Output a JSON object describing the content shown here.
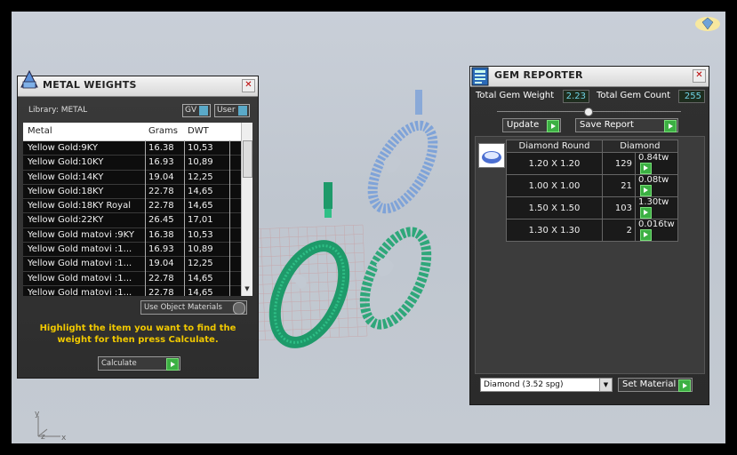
{
  "metal_weights": {
    "title": "METAL WEIGHTS",
    "close": "✕",
    "library": "Library: METAL",
    "toggle_gv": "GV",
    "toggle_user": "User",
    "columns": [
      "Metal",
      "Grams",
      "DWT"
    ],
    "rows": [
      {
        "metal": "Yellow Gold:9KY",
        "grams": "16.38",
        "dwt": "10,53"
      },
      {
        "metal": "Yellow Gold:10KY",
        "grams": "16.93",
        "dwt": "10,89"
      },
      {
        "metal": "Yellow Gold:14KY",
        "grams": "19.04",
        "dwt": "12,25"
      },
      {
        "metal": "Yellow Gold:18KY",
        "grams": "22.78",
        "dwt": "14,65"
      },
      {
        "metal": "Yellow Gold:18KY Royal",
        "grams": "22.78",
        "dwt": "14,65"
      },
      {
        "metal": "Yellow Gold:22KY",
        "grams": "26.45",
        "dwt": "17,01"
      },
      {
        "metal": "Yellow Gold matovi :9KY",
        "grams": "16.38",
        "dwt": "10,53"
      },
      {
        "metal": "Yellow Gold matovi :1...",
        "grams": "16.93",
        "dwt": "10,89"
      },
      {
        "metal": "Yellow Gold matovi :1...",
        "grams": "19.04",
        "dwt": "12,25"
      },
      {
        "metal": "Yellow Gold matovi :1...",
        "grams": "22.78",
        "dwt": "14,65"
      },
      {
        "metal": "Yellow Gold matovi :1...",
        "grams": "22.78",
        "dwt": "14,65"
      }
    ],
    "use_object_materials": "Use Object Materials",
    "hint": "Highlight the item you want to find the weight for then press Calculate.",
    "calculate": "Calculate"
  },
  "gem_reporter": {
    "title": "GEM REPORTER",
    "close": "✕",
    "total_gem_weight_label": "Total Gem Weight",
    "total_gem_weight": "2.23",
    "total_gem_count_label": "Total Gem Count",
    "total_gem_count": "255",
    "update": "Update",
    "save_report": "Save Report",
    "table_headers": [
      "Diamond Round",
      "Diamond"
    ],
    "rows": [
      {
        "size": "1.20 X 1.20",
        "count": "129",
        "weight": "0.84tw"
      },
      {
        "size": "1.00 X 1.00",
        "count": "21",
        "weight": "0.08tw"
      },
      {
        "size": "1.50 X 1.50",
        "count": "103",
        "weight": "1.30tw"
      },
      {
        "size": "1.30 X 1.30",
        "count": "2",
        "weight": "0.016tw"
      }
    ],
    "material_select": "Diamond     (3.52 spg)",
    "set_material": "Set Material"
  },
  "viewport": {
    "axis_y": "y",
    "axis_z": "z",
    "axis_x": "x"
  },
  "colors": {
    "accent_green": "#3cb043",
    "hint_yellow": "#f0c800",
    "value_cyan": "#6fd3e6",
    "mesh_green": "#1e9a6a",
    "mesh_blue": "#7fa3d8"
  },
  "icons": [
    "gem-reporter-icon",
    "metal-weights-icon",
    "close-icon",
    "go-arrow-icon",
    "diamond-icon",
    "dropdown-arrow-icon",
    "brand-gem-icon"
  ]
}
